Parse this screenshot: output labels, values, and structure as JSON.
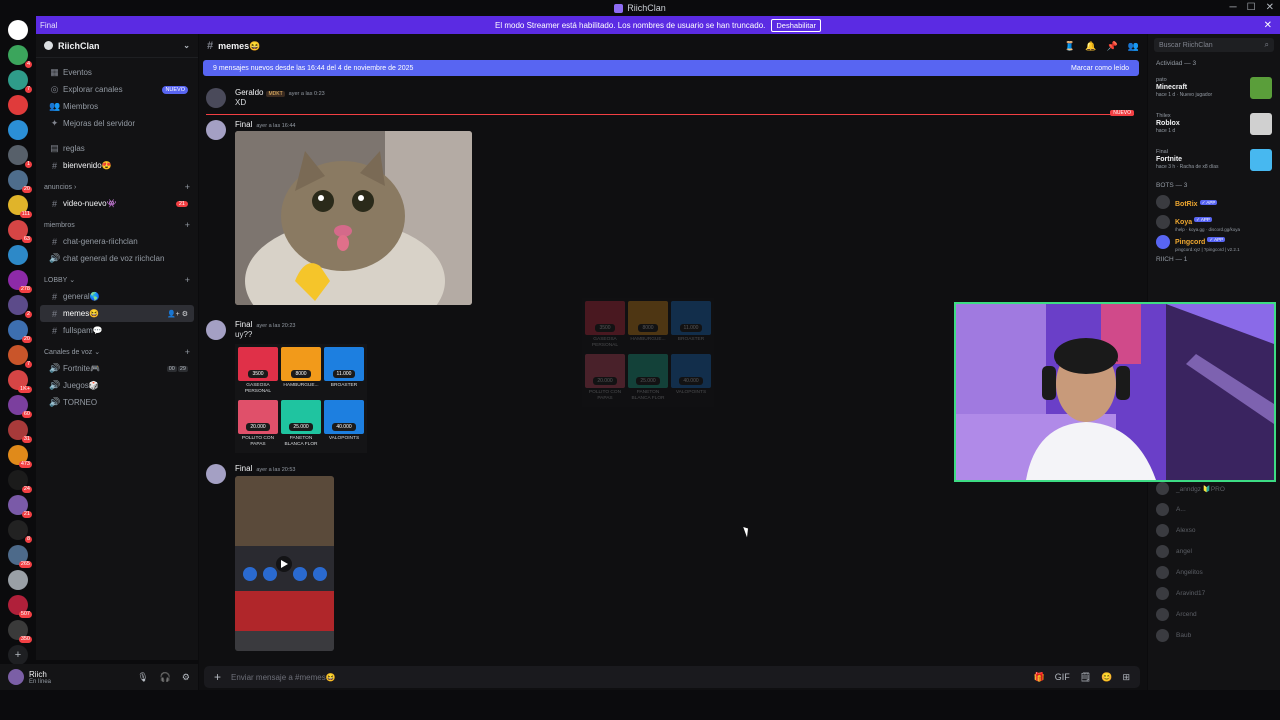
{
  "window": {
    "title": "RiichClan",
    "controls": [
      "─",
      "☐",
      "✕"
    ]
  },
  "streamer_banner": {
    "left_label": "Final",
    "text": "El modo Streamer está habilitado. Los nombres de usuario se han truncado.",
    "button": "Deshabilitar"
  },
  "servers": [
    {
      "color": "#ffffff",
      "badge": ""
    },
    {
      "color": "#3ba55c",
      "badge": "4"
    },
    {
      "color": "#2f9c8a",
      "badge": "7"
    },
    {
      "color": "#e03b3b",
      "badge": ""
    },
    {
      "color": "#2b8fd6",
      "badge": ""
    },
    {
      "color": "#57606a",
      "badge": "1"
    },
    {
      "color": "#4e6d8c",
      "badge": "20"
    },
    {
      "color": "#e0b42a",
      "badge": "111"
    },
    {
      "color": "#d64545",
      "badge": "63"
    },
    {
      "color": "#2d89c8",
      "badge": ""
    },
    {
      "color": "#8d2aa8",
      "badge": "278"
    },
    {
      "color": "#5c4b8a",
      "badge": "2"
    },
    {
      "color": "#3d6fb0",
      "badge": "20"
    },
    {
      "color": "#c9552a",
      "badge": "7"
    },
    {
      "color": "#d64545",
      "badge": "1K+"
    },
    {
      "color": "#7b3f9e",
      "badge": "60"
    },
    {
      "color": "#a83a3a",
      "badge": "31"
    },
    {
      "color": "#e08a1a",
      "badge": "473"
    },
    {
      "color": "#1b1b1b",
      "badge": "24"
    },
    {
      "color": "#7a5aa8",
      "badge": "21"
    },
    {
      "color": "#222222",
      "badge": "8"
    },
    {
      "color": "#4d6a8a",
      "badge": "265"
    },
    {
      "color": "#9aa0a6",
      "badge": ""
    },
    {
      "color": "#b0203a",
      "badge": "507"
    },
    {
      "color": "#3a3a3a",
      "badge": "350"
    }
  ],
  "guild": {
    "name": "RiichClan"
  },
  "channels": {
    "top": [
      {
        "icon": "▦",
        "label": "Eventos",
        "tag": ""
      },
      {
        "icon": "◎",
        "label": "Explorar canales",
        "tag": "NUEVO"
      },
      {
        "icon": "👥",
        "label": "Miembros",
        "tag": ""
      },
      {
        "icon": "✦",
        "label": "Mejoras del servidor",
        "tag": ""
      }
    ],
    "free": [
      {
        "icon": "▤",
        "label": "reglas"
      },
      {
        "icon": "#",
        "label": "bienvenido😍"
      }
    ],
    "cat_anuncios": "anuncios",
    "anuncios": [
      {
        "icon": "#",
        "label": "video-nuevo👾",
        "count": "21"
      }
    ],
    "cat_miembros": "miembros",
    "miembros": [
      {
        "icon": "#",
        "label": "chat-genera-riichclan"
      },
      {
        "icon": "🔊",
        "label": "chat general de voz riichclan"
      }
    ],
    "cat_lobby": "LOBBY",
    "lobby": [
      {
        "icon": "#",
        "label": "general🌎"
      },
      {
        "icon": "#",
        "label": "memes😆",
        "actions": "👤+ ⚙"
      },
      {
        "icon": "#",
        "label": "fullspam💬"
      }
    ],
    "cat_voz": "Canales de voz",
    "voz": [
      {
        "icon": "🔊",
        "label": "Fortnite🎮",
        "vc1": "00",
        "vc2": "29"
      },
      {
        "icon": "🔊",
        "label": "Juegos🎲"
      },
      {
        "icon": "🔊",
        "label": "TORNEO"
      }
    ]
  },
  "user": {
    "name": "Riich",
    "status": "En línea",
    "controls": [
      "🎙",
      "🎧",
      "⚙"
    ]
  },
  "channel_header": {
    "name": "memes😆",
    "tools": [
      "🧵",
      "🔔",
      "📌",
      "👥"
    ]
  },
  "new_messages_bar": {
    "text": "9 mensajes nuevos desde las 16:44 del 4 de noviembre de 2025",
    "action": "Marcar como leído"
  },
  "messages": [
    {
      "author": "Geraldo",
      "tag": "MDKT",
      "time": "ayer a las 0:23",
      "text": "XD"
    },
    {
      "author": "Final",
      "time": "ayer a las 16:44",
      "text": ""
    },
    {
      "author": "Final",
      "time": "ayer a las 20:23",
      "text": "uy??"
    },
    {
      "author": "Final",
      "time": "ayer a las 20:53",
      "text": ""
    }
  ],
  "new_divider": "NUEVO",
  "menu": [
    {
      "price": "3500",
      "label": "GASEOSA PERSONAL",
      "color": "#e03048"
    },
    {
      "price": "8000",
      "label": "HAMBURGUE...",
      "color": "#f29a1a"
    },
    {
      "price": "11.000",
      "label": "BROASTER",
      "color": "#1d7fe0"
    },
    {
      "price": "20.000",
      "label": "POLLITO CON PAPAS",
      "color": "#e0506a"
    },
    {
      "price": "25.000",
      "label": "PANETON BLANCA FLOR",
      "color": "#1fc4a0"
    },
    {
      "price": "40.000",
      "label": "VALOPOINTS",
      "color": "#1d7fe0"
    }
  ],
  "composer": {
    "placeholder": "Enviar mensaje a #memes😆",
    "icons": [
      "🎁",
      "GIF",
      "🗒",
      "😊",
      "⊞"
    ]
  },
  "sidebar_right": {
    "search_placeholder": "Buscar RiichClan",
    "activity_header": "Actividad — 3",
    "activity": [
      {
        "who": "pato",
        "game": "Minecraft",
        "meta": "hace 1 d · Nuevo jugador",
        "color": "#5a9e3a"
      },
      {
        "who": "Thilex",
        "game": "Roblox",
        "meta": "hace 1 d",
        "color": "#d0d0d0"
      },
      {
        "who": "Final",
        "game": "Fortnite",
        "meta": "hace 3 h · Racha de x8 días",
        "color": "#47b8f0"
      }
    ],
    "bots_header": "BOTS — 3",
    "bots": [
      {
        "name": "BotRix",
        "sub": "",
        "color": "#f0a830"
      },
      {
        "name": "Koya",
        "sub": "/help · koya.gg · discord.gg/koya",
        "color": "#f0a830"
      },
      {
        "name": "Pingcord",
        "sub": "pingcord.xyz | ?pingcord | v2.2.1",
        "color": "#f0a830"
      }
    ],
    "riich_header": "RIICH — 1",
    "members": [
      "@_..sleeeee",
      "...",
      "_anndgz 🔰PRO",
      "A...",
      "Alexso",
      "angel",
      "Angelitos",
      "Aravind17",
      "Arcend",
      "Baub"
    ]
  }
}
